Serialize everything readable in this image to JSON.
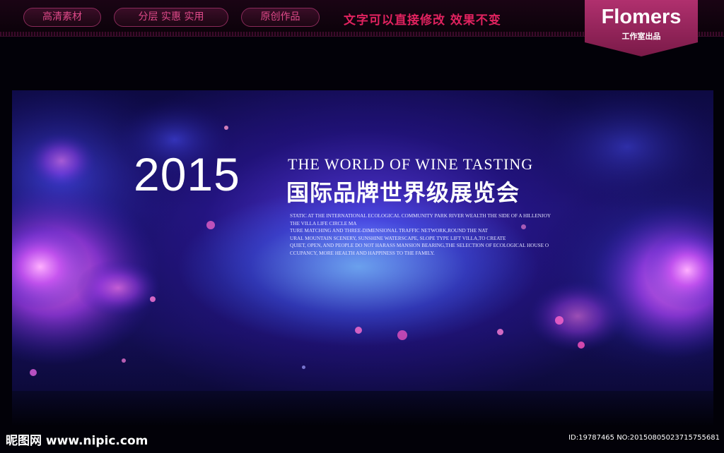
{
  "top_bar": {
    "tags": [
      "高清素材",
      "分层 实惠 实用",
      "原创作品"
    ],
    "slogan": "文字可以直接修改 效果不变"
  },
  "logo": {
    "title": "Flomers",
    "subtitle": "工作室出品"
  },
  "banner": {
    "year": "2015",
    "english_title": "THE WORLD OF WINE TASTING",
    "chinese_title": "国际品牌世界级展览会",
    "body_lines": [
      "STATIC AT THE INTERNATIONAL ECOLOGICAL COMMUNITY PARK RIVER WEALTH THE SIDE OF A HILLENJOY",
      "THE VILLA LIFE CIRCLE MA",
      "TURE MATCHING AND THREE-DIMENSIONAL TRAFFIC NETWORK,ROUND THE NAT",
      "URAL MOUNTAIN SCENERY, SUNSHINE WATERSCAPE, SLOPE TYPE LIFT VILLA,TO CREATE",
      "QUIET, OPEN, AND PEOPLE DO NOT HARASS MANSION BEARING,THE SELECTION OF ECOLOGICAL HOUSE O",
      "CCUPANCY, MORE HEALTH AND HAPPINESS TO THE FAMILY."
    ]
  },
  "footer": {
    "watermark": "昵图网 www.nipic.com",
    "id_text": "ID:19787465 NO:20150805023715755681"
  },
  "colors": {
    "accent_pink": "#e0225f",
    "logo_magenta": "#a02a62",
    "banner_blue": "#2a1e9a"
  }
}
